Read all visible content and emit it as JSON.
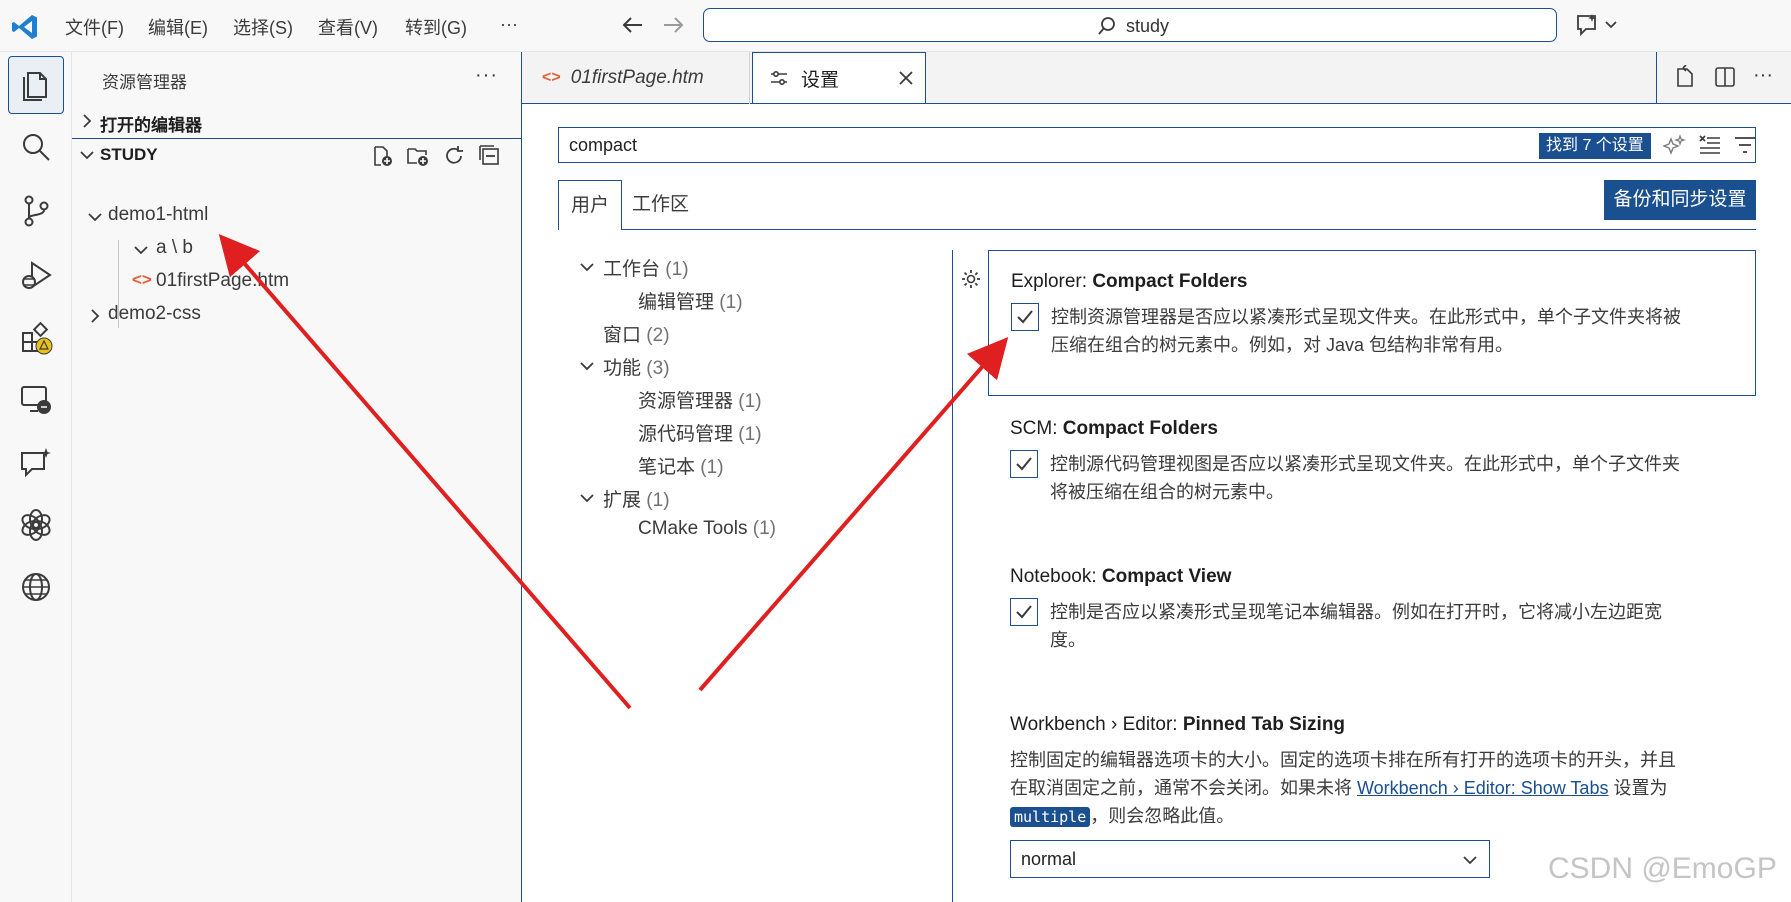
{
  "menu": [
    "文件(F)",
    "编辑(E)",
    "选择(S)",
    "查看(V)",
    "转到(G)",
    "···"
  ],
  "command_center": {
    "text": "study"
  },
  "sidebar": {
    "title": "资源管理器",
    "more": "···",
    "open_editors": "打开的编辑器",
    "workspace": "STUDY",
    "tree": {
      "demo1": "demo1-html",
      "ab": "a \\ b",
      "file": "01firstPage.htm",
      "demo2": "demo2-css"
    }
  },
  "tabs": {
    "tab1": "01firstPage.htm",
    "tab2": "设置"
  },
  "settings": {
    "search_value": "compact",
    "found": "找到 7 个设置",
    "scope_user": "用户",
    "scope_workspace": "工作区",
    "sync_button": "备份和同步设置",
    "toc": [
      {
        "label": "工作台",
        "count": "(1)"
      },
      {
        "label": "编辑管理",
        "count": "(1)"
      },
      {
        "label": "窗口",
        "count": "(2)"
      },
      {
        "label": "功能",
        "count": "(3)"
      },
      {
        "label": "资源管理器",
        "count": "(1)"
      },
      {
        "label": "源代码管理",
        "count": "(1)"
      },
      {
        "label": "笔记本",
        "count": "(1)"
      },
      {
        "label": "扩展",
        "count": "(1)"
      },
      {
        "label": "CMake Tools",
        "count": "(1)"
      }
    ],
    "items": {
      "explorer": {
        "category": "Explorer: ",
        "name": "Compact Folders",
        "desc1": "控制资源管理器是否应以紧凑形式呈现文件夹。在此形式中，单个子文件夹将被",
        "desc2": "压缩在组合的树元素中。例如，对 Java 包结构非常有用。"
      },
      "scm": {
        "category": "SCM: ",
        "name": "Compact Folders",
        "desc1": "控制源代码管理视图是否应以紧凑形式呈现文件夹。在此形式中，单个子文件夹",
        "desc2": "将被压缩在组合的树元素中。"
      },
      "notebook": {
        "category": "Notebook: ",
        "name": "Compact View",
        "desc1": "控制是否应以紧凑形式呈现笔记本编辑器。例如在打开时，它将减小左边距宽",
        "desc2": "度。"
      },
      "pinned": {
        "category": "Workbench › Editor: ",
        "name": "Pinned Tab Sizing",
        "desc1": "控制固定的编辑器选项卡的大小。固定的选项卡排在所有打开的选项卡的开头，并且",
        "desc2a": "在取消固定之前，通常不会关闭。如果未将 ",
        "link": "Workbench › Editor: Show Tabs",
        "desc2b": " 设置为",
        "code": "multiple",
        "desc3": "，则会忽略此值。",
        "select_value": "normal"
      }
    }
  },
  "watermark": "CSDN @EmoGP",
  "colors": {
    "accent": "#1a4f90",
    "arrow": "#e02020"
  }
}
